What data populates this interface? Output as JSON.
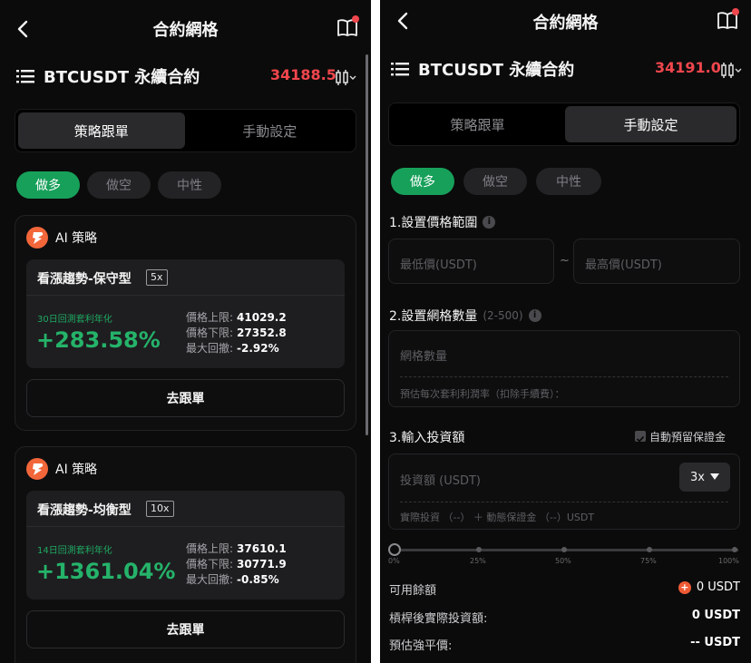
{
  "left": {
    "nav": {
      "title": "合約網格"
    },
    "symbol": {
      "name": "BTCUSDT 永續合約",
      "price": "34188.5"
    },
    "tabs": {
      "strategy": "策略跟單",
      "manual": "手動設定"
    },
    "chips": {
      "long": "做多",
      "short": "做空",
      "neutral": "中性"
    },
    "cards": [
      {
        "ai_label": "AI 策略",
        "name": "看漲趨勢-保守型",
        "leverage": "5x",
        "period": "30日回測套利年化",
        "apr": "+283.58%",
        "upper_label": "價格上限:",
        "upper": "41029.2",
        "lower_label": "價格下限:",
        "lower": "27352.8",
        "drawdown_label": "最大回撤:",
        "drawdown": "-2.92%",
        "follow": "去跟單"
      },
      {
        "ai_label": "AI 策略",
        "name": "看漲趨勢-均衡型",
        "leverage": "10x",
        "period": "14日回測套利年化",
        "apr": "+1361.04%",
        "upper_label": "價格上限:",
        "upper": "37610.1",
        "lower_label": "價格下限:",
        "lower": "30771.9",
        "drawdown_label": "最大回撤:",
        "drawdown": "-0.85%",
        "follow": "去跟單"
      }
    ]
  },
  "right": {
    "nav": {
      "title": "合約網格"
    },
    "symbol": {
      "name": "BTCUSDT 永續合約",
      "price": "34191.0"
    },
    "tabs": {
      "strategy": "策略跟單",
      "manual": "手動設定"
    },
    "chips": {
      "long": "做多",
      "short": "做空",
      "neutral": "中性"
    },
    "price_range": {
      "label": "1.設置價格範圍",
      "min_placeholder": "最低價(USDT)",
      "tilde": "~",
      "max_placeholder": "最高價(USDT)"
    },
    "grid_count": {
      "label": "2.設置網格數量",
      "hint": "(2-500)",
      "placeholder": "網格數量",
      "sub": "預估每次套利利潤率（扣除手續費）："
    },
    "investment": {
      "label": "3.輸入投資額",
      "auto_reserve": "自動預留保證金",
      "placeholder": "投資額 (USDT)",
      "leverage": "3x",
      "sub": "實際投資 （--） ＋ 動態保證金 （--）USDT",
      "slider_value": 0,
      "ticks": [
        "0%",
        "25%",
        "50%",
        "75%",
        "100%"
      ]
    },
    "summary": {
      "available_label": "可用餘額",
      "available_value": "0 USDT",
      "leveraged_label": "槓桿後實際投資額:",
      "leveraged_value": "0 USDT",
      "liq_label": "預估強平價:",
      "liq_value": "-- USDT"
    }
  },
  "colors": {
    "background": "#0b0b0b",
    "accent_green": "#17a05a",
    "price_red": "#f0464d",
    "badge_orange": "#f2663a"
  }
}
